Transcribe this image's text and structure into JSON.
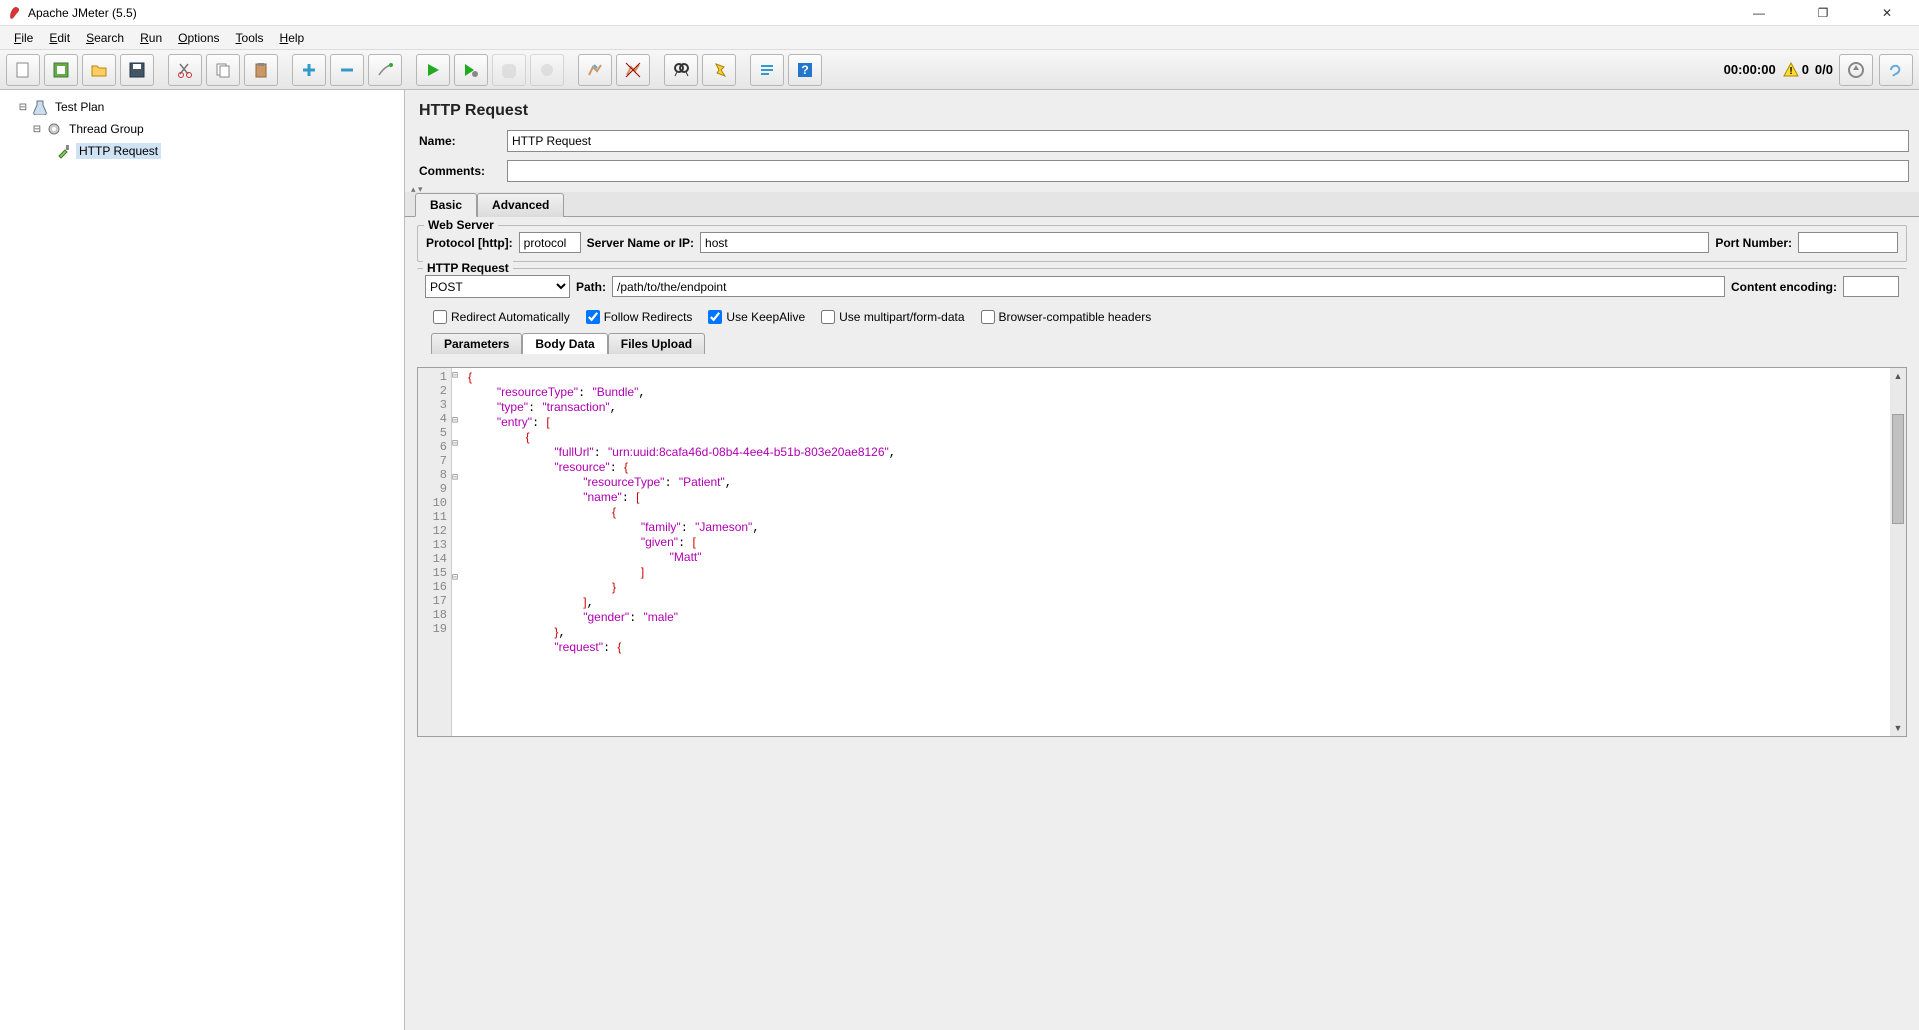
{
  "title": "Apache JMeter (5.5)",
  "window_controls": {
    "minimize": "—",
    "maximize": "❐",
    "close": "✕"
  },
  "menu": {
    "file": "File",
    "edit": "Edit",
    "search": "Search",
    "run": "Run",
    "options": "Options",
    "tools": "Tools",
    "help": "Help"
  },
  "status": {
    "timer": "00:00:00",
    "warnings": "0",
    "ratio": "0/0"
  },
  "tree": {
    "test_plan": "Test Plan",
    "thread_group": "Thread Group",
    "http_request": "HTTP Request"
  },
  "panel": {
    "title": "HTTP Request",
    "name_label": "Name:",
    "name_value": "HTTP Request",
    "comments_label": "Comments:",
    "comments_value": "",
    "tab_basic": "Basic",
    "tab_advanced": "Advanced"
  },
  "webserver": {
    "legend": "Web Server",
    "protocol_label": "Protocol [http]:",
    "protocol_value": "protocol",
    "server_label": "Server Name or IP:",
    "server_value": "host",
    "port_label": "Port Number:",
    "port_value": ""
  },
  "httpreq": {
    "legend": "HTTP Request",
    "method_value": "POST",
    "path_label": "Path:",
    "path_value": "/path/to/the/endpoint",
    "enc_label": "Content encoding:",
    "enc_value": ""
  },
  "checks": {
    "redirect_auto": "Redirect Automatically",
    "follow_redirects": "Follow Redirects",
    "keepalive": "Use KeepAlive",
    "multipart": "Use multipart/form-data",
    "browser_headers": "Browser-compatible headers"
  },
  "inner_tabs": {
    "parameters": "Parameters",
    "body_data": "Body Data",
    "files_upload": "Files Upload"
  },
  "editor": {
    "lines": [
      {
        "n": "1",
        "fold": "⊟",
        "html": "<span class='br'>{</span>"
      },
      {
        "n": "2",
        "fold": " ",
        "html": "    <span class='key'>\"resourceType\"</span>: <span class='str'>\"Bundle\"</span>,"
      },
      {
        "n": "3",
        "fold": " ",
        "html": "    <span class='key'>\"type\"</span>: <span class='str'>\"transaction\"</span>,"
      },
      {
        "n": "4",
        "fold": " ",
        "html": "    <span class='key'>\"entry\"</span>: <span class='br'>[</span>"
      },
      {
        "n": "5",
        "fold": "⊟",
        "html": "        <span class='br'>{</span>"
      },
      {
        "n": "6",
        "fold": " ",
        "html": "            <span class='key'>\"fullUrl\"</span>: <span class='str'>\"urn:uuid:8cafa46d-08b4-4ee4-b51b-803e20ae8126\"</span>,"
      },
      {
        "n": "7",
        "fold": "⊟",
        "html": "            <span class='key'>\"resource\"</span>: <span class='br'>{</span>"
      },
      {
        "n": "8",
        "fold": " ",
        "html": "                <span class='key'>\"resourceType\"</span>: <span class='str'>\"Patient\"</span>,"
      },
      {
        "n": "9",
        "fold": " ",
        "html": "                <span class='key'>\"name\"</span>: <span class='br'>[</span>"
      },
      {
        "n": "10",
        "fold": "⊟",
        "html": "                    <span class='br'>{</span>"
      },
      {
        "n": "11",
        "fold": " ",
        "html": "                        <span class='key'>\"family\"</span>: <span class='str'>\"Jameson\"</span>,"
      },
      {
        "n": "12",
        "fold": " ",
        "html": "                        <span class='key'>\"given\"</span>: <span class='br'>[</span>"
      },
      {
        "n": "13",
        "fold": " ",
        "html": "                            <span class='str'>\"Matt\"</span>"
      },
      {
        "n": "14",
        "fold": " ",
        "html": "                        <span class='br'>]</span>"
      },
      {
        "n": "15",
        "fold": " ",
        "html": "                    <span class='br'>}</span>"
      },
      {
        "n": "16",
        "fold": " ",
        "html": "                <span class='br'>]</span>,"
      },
      {
        "n": "17",
        "fold": " ",
        "html": "                <span class='key'>\"gender\"</span>: <span class='str'>\"male\"</span>"
      },
      {
        "n": "18",
        "fold": " ",
        "html": "            <span class='br'>}</span>,"
      },
      {
        "n": "19",
        "fold": "⊟",
        "html": "            <span class='key'>\"request\"</span>: <span class='br'>{</span>"
      }
    ]
  }
}
